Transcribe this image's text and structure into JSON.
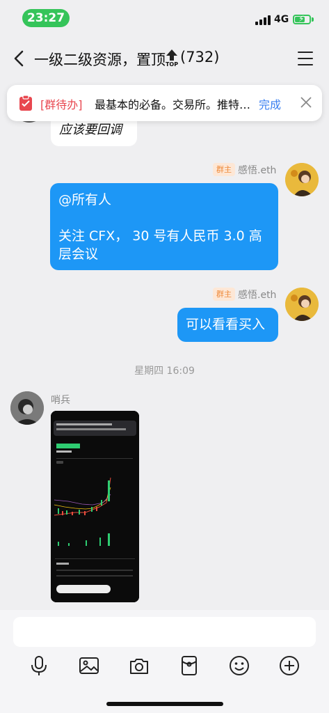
{
  "status_bar": {
    "time": "23:27",
    "network": "4G"
  },
  "nav": {
    "title": "一级二级资源，置顶",
    "top_badge": "TOP",
    "member_count": "(732)"
  },
  "todo": {
    "tag": "[群待办]",
    "text": "最基本的必备。交易所。推特…",
    "done_label": "完成"
  },
  "messages": {
    "partial_text": "应该要回调",
    "msg1": {
      "badge": "群主",
      "sender": "感悟.eth",
      "line1": "@所有人",
      "line2": "关注 CFX， 30 号有人民币 3.0 高",
      "line3": "层会议"
    },
    "msg2": {
      "badge": "群主",
      "sender": "感悟.eth",
      "text": "可以看看买入"
    },
    "time_divider": "星期四 16:09",
    "msg3": {
      "sender": "哨兵"
    }
  },
  "input": {
    "placeholder": ""
  },
  "toolbar": [
    "microphone-icon",
    "image-icon",
    "camera-icon",
    "red-packet-icon",
    "emoji-icon",
    "plus-icon"
  ],
  "colors": {
    "accent_blue": "#1d97f6",
    "owner_badge_bg": "#fde7d6",
    "owner_badge_text": "#ee8a3b",
    "todo_tag": "#e8474f",
    "status_green": "#35c45a"
  }
}
